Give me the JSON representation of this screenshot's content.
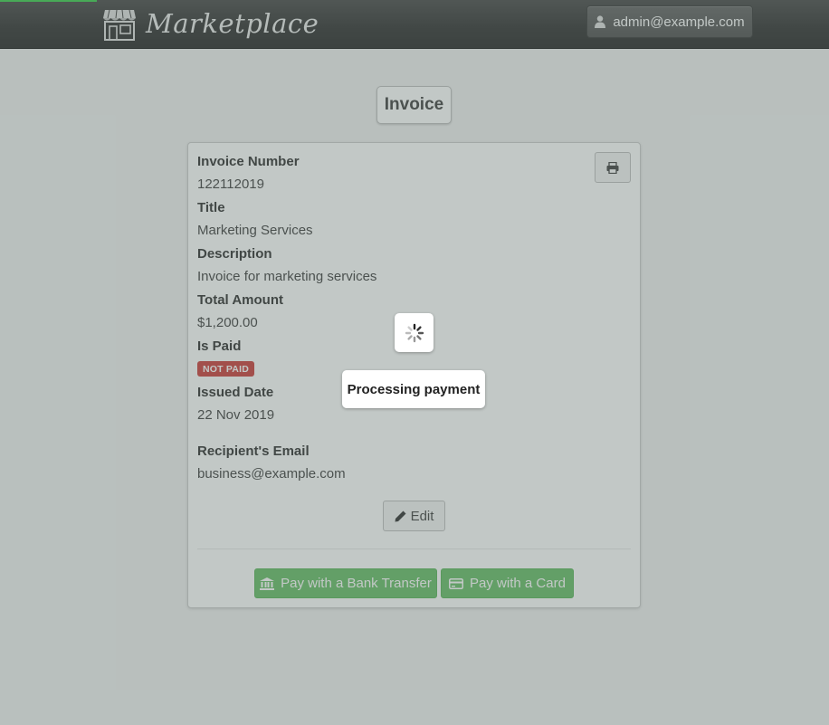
{
  "navbar": {
    "brand_name": "Marketplace",
    "logo_icon": "storefront-icon",
    "user_email": "admin@example.com",
    "user_icon": "user-icon"
  },
  "page": {
    "title": "Invoice"
  },
  "invoice": {
    "fields": [
      {
        "label": "Invoice Number",
        "value": "122112019"
      },
      {
        "label": "Title",
        "value": "Marketing Services"
      },
      {
        "label": "Description",
        "value": "Invoice for marketing services"
      },
      {
        "label": "Total Amount",
        "value": "$1,200.00"
      },
      {
        "label": "Is Paid",
        "badge": "NOT PAID"
      },
      {
        "label": "Issued Date",
        "value": "22 Nov 2019"
      },
      {
        "label": "Recipient's Email",
        "value": "business@example.com"
      }
    ],
    "print_icon": "print-icon"
  },
  "actions": {
    "edit_label": "Edit",
    "pay_bank_label": "Pay with a Bank Transfer",
    "pay_card_label": "Pay with a Card"
  },
  "overlay": {
    "message": "Processing payment"
  },
  "colors": {
    "success": "#5cb85c",
    "danger": "#c9302c",
    "navbar": "#222222"
  }
}
